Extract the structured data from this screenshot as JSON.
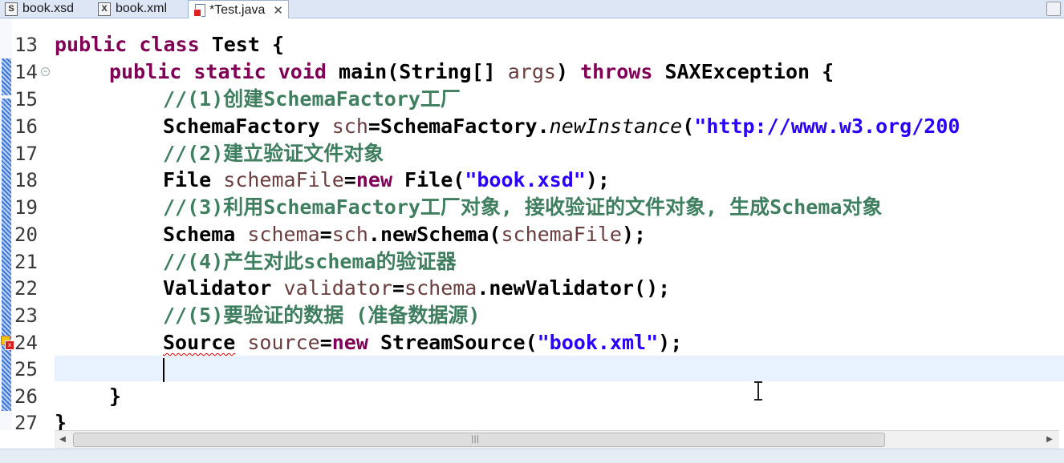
{
  "tabs": [
    {
      "label": "book.xsd",
      "icon": "S"
    },
    {
      "label": "book.xml",
      "icon": "X"
    },
    {
      "label": "*Test.java",
      "close": "✕"
    }
  ],
  "editor": {
    "line_numbers": [
      "13",
      "14",
      "15",
      "16",
      "17",
      "18",
      "19",
      "20",
      "21",
      "22",
      "23",
      "24",
      "25",
      "26",
      "27"
    ],
    "code": {
      "l13": {
        "kw1": "public",
        "kw2": "class",
        "rest": " Test {"
      },
      "l14": {
        "kw1": "public",
        "kw2": "static",
        "kw3": "void",
        "p1": " main(String[] ",
        "var": "args",
        "p2": ") ",
        "kw4": "throws",
        "p3": " SAXException {"
      },
      "l15": "//(1)创建SchemaFactory工厂",
      "l16": {
        "p1": "SchemaFactory ",
        "var": "sch",
        "p2": "=SchemaFactory.",
        "method": "newInstance",
        "p3": "(",
        "str": "\"http://www.w3.org/200"
      },
      "l17": "//(2)建立验证文件对象",
      "l18": {
        "p1": "File ",
        "var": "schemaFile",
        "p2": "=",
        "kw": "new",
        "p3": " File(",
        "str": "\"book.xsd\"",
        "p4": ");"
      },
      "l19": "//(3)利用SchemaFactory工厂对象, 接收验证的文件对象, 生成Schema对象",
      "l20": {
        "p1": "Schema ",
        "var1": "schema",
        "p2": "=",
        "var2": "sch",
        "p3": ".newSchema(",
        "var3": "schemaFile",
        "p4": ");"
      },
      "l21": "//(4)产生对此schema的验证器",
      "l22": {
        "p1": "Validator ",
        "var1": "validator",
        "p2": "=",
        "var2": "schema",
        "p3": ".newValidator();"
      },
      "l23": "//(5)要验证的数据 (准备数据源)",
      "l24": {
        "type": "Source",
        "sp": " ",
        "var": "source",
        "p2": "=",
        "kw": "new",
        "p3": " StreamSource(",
        "str": "\"book.xml\"",
        "p4": ");"
      },
      "l26": "}",
      "l27": "}"
    }
  },
  "scrollbar": {
    "left_arrow": "◀",
    "right_arrow": "▶",
    "grip": "|||"
  }
}
